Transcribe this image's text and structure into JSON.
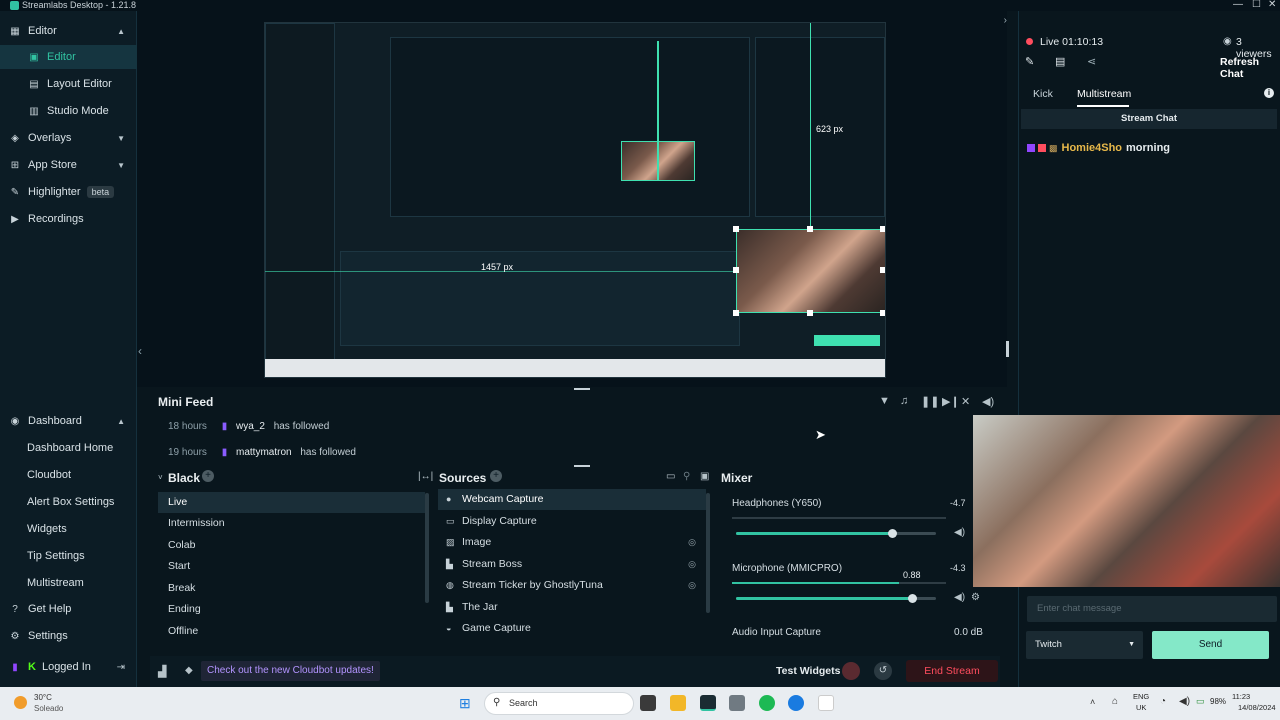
{
  "app": {
    "title": "Streamlabs Desktop - 1.21.8"
  },
  "sidebar": {
    "top": [
      {
        "label": "Editor",
        "icon": "grid-icon"
      },
      {
        "label": "Editor",
        "icon": "layout-icon"
      },
      {
        "label": "Layout Editor",
        "icon": "layout-editor-icon"
      },
      {
        "label": "Studio Mode",
        "icon": "studio-mode-icon"
      },
      {
        "label": "Overlays",
        "icon": "overlays-icon"
      },
      {
        "label": "App Store",
        "icon": "store-icon"
      },
      {
        "label": "Highlighter",
        "icon": "highlighter-icon",
        "badge": "beta"
      },
      {
        "label": "Recordings",
        "icon": "recordings-icon"
      }
    ],
    "bottom": [
      {
        "label": "Dashboard",
        "icon": "dashboard-icon"
      },
      {
        "label": "Dashboard Home"
      },
      {
        "label": "Cloudbot"
      },
      {
        "label": "Alert Box Settings"
      },
      {
        "label": "Widgets"
      },
      {
        "label": "Tip Settings"
      },
      {
        "label": "Multistream"
      },
      {
        "label": "Get Help",
        "icon": "help-icon"
      },
      {
        "label": "Settings",
        "icon": "settings-icon"
      },
      {
        "label": "Logged In",
        "icon": "kick-icon"
      }
    ]
  },
  "preview": {
    "dim_label": "623 px",
    "dim_label2": "1457 px"
  },
  "minifeed": {
    "title": "Mini Feed",
    "rows": [
      {
        "ago": "18 hours",
        "user": "wya_2",
        "action": "has followed"
      },
      {
        "ago": "19 hours",
        "user": "mattymatron",
        "action": "has followed"
      }
    ]
  },
  "scenes": {
    "title": "Black",
    "items": [
      "Live",
      "Intermission",
      "Colab",
      "Start",
      "Break",
      "Ending",
      "Offline"
    ]
  },
  "sources": {
    "title": "Sources",
    "items": [
      "Webcam Capture",
      "Display Capture",
      "Image",
      "Stream Boss",
      "Stream Ticker by GhostlyTuna",
      "The Jar",
      "Game Capture"
    ]
  },
  "mixer": {
    "title": "Mixer",
    "channels": [
      {
        "name": "Headphones (Y650)",
        "db": "-4.7",
        "level": 0.78
      },
      {
        "name": "Microphone (MMICPRO)",
        "db": "-4.3",
        "value": "0.88",
        "level": 0.88
      },
      {
        "name": "Audio Input Capture",
        "db": "0.0 dB"
      }
    ]
  },
  "bottombar": {
    "cloudbot_notice": "Check out the new Cloudbot updates!",
    "test_widgets": "Test Widgets",
    "end_stream": "End Stream"
  },
  "chat": {
    "live": "Live 01:10:13",
    "viewers": "3 viewers",
    "refresh": "Refresh Chat",
    "tabs": [
      "Kick",
      "Multistream"
    ],
    "header": "Stream Chat",
    "messages": [
      {
        "user": "Homie4Sho",
        "text": "morning"
      }
    ],
    "input_placeholder": "Enter chat message",
    "platform": "Twitch",
    "send": "Send"
  },
  "taskbar": {
    "weather_temp": "30°C",
    "weather_desc": "Soleado",
    "search": "Search",
    "lang": "ENG",
    "region": "UK",
    "battery": "98%",
    "time": "11:23",
    "date": "14/08/2024"
  },
  "colors": {
    "accent": "#31c3a2",
    "danger": "#ff4d5e",
    "kick": "#53fc18",
    "twitch": "#9146ff"
  }
}
